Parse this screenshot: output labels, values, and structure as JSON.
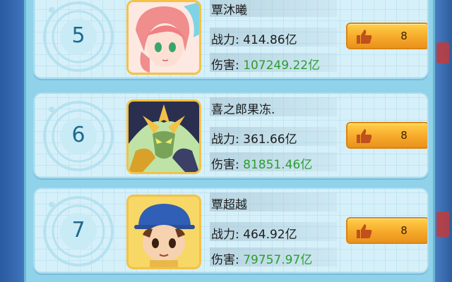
{
  "entries": [
    {
      "rank": "5",
      "name": "覃沐曦",
      "power_label": "战力:",
      "power": "414.86亿",
      "damage_label": "伤害:",
      "damage": "107249.22亿",
      "likes": "8",
      "avatar": "pink-haired-girl-avatar"
    },
    {
      "rank": "6",
      "name": "喜之郎果冻.",
      "power_label": "战力:",
      "power": "361.66亿",
      "damage_label": "伤害:",
      "damage": "81851.46亿",
      "likes": "8",
      "avatar": "armored-dragon-knight-avatar"
    },
    {
      "rank": "7",
      "name": "覃超越",
      "power_label": "战力:",
      "power": "464.92亿",
      "damage_label": "伤害:",
      "damage": "79757.97亿",
      "likes": "8",
      "avatar": "boy-blue-cap-avatar"
    }
  ],
  "colors": {
    "damage_text": "#2e9c2e",
    "like_button": "#f6a92b",
    "rank_number": "#1e6a8e",
    "card_bg": "#d6f0f9"
  },
  "icons": {
    "like": "thumbs-up-icon"
  }
}
